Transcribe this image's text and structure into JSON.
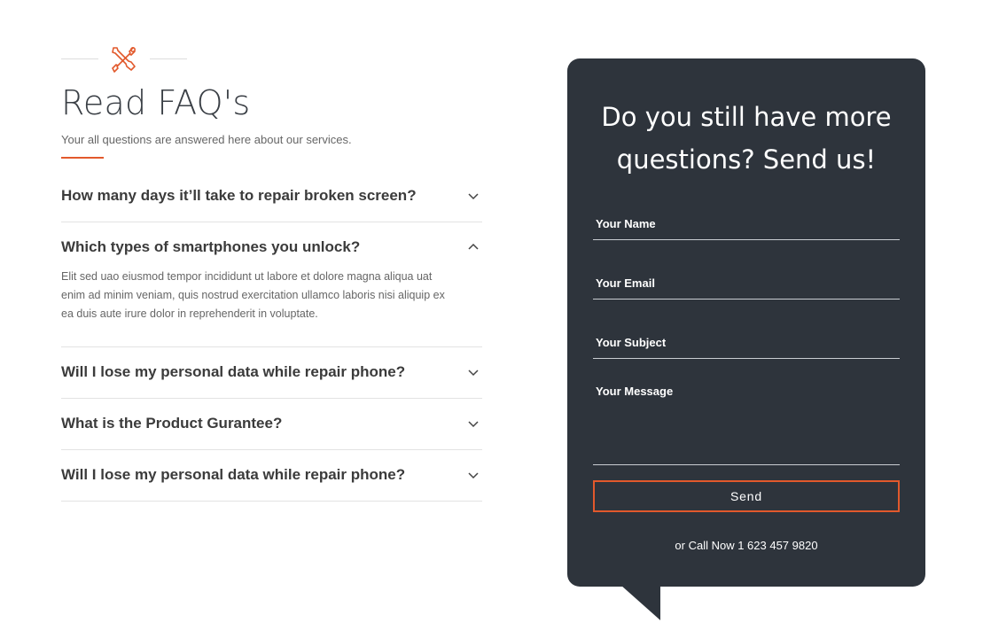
{
  "header": {
    "icon": "tools-icon",
    "title": "Read FAQ's",
    "subtitle": "Your all questions are answered here about our services."
  },
  "colors": {
    "accent": "#e2592c",
    "panel": "#2e343c"
  },
  "faq": [
    {
      "question": "How many days it’ll take to repair broken screen?",
      "expanded": false
    },
    {
      "question": "Which types of smartphones you unlock?",
      "expanded": true,
      "answer": "Elit sed uao eiusmod tempor incididunt ut labore et dolore magna aliqua uat enim ad minim veniam, quis nostrud exercitation ullamco laboris nisi aliquip ex ea duis aute irure dolor in reprehenderit in voluptate."
    },
    {
      "question": "Will I lose my personal data while repair phone?",
      "expanded": false
    },
    {
      "question": "What is the Product Gurantee?",
      "expanded": false
    },
    {
      "question": "Will I lose my personal data while repair phone?",
      "expanded": false
    }
  ],
  "contact": {
    "heading": "Do you still have more questions? Send us!",
    "name_placeholder": "Your Name",
    "email_placeholder": "Your Email",
    "subject_placeholder": "Your Subject",
    "message_placeholder": "Your Message",
    "send_label": "Send",
    "call_text": "or Call Now 1 623 457 9820"
  }
}
